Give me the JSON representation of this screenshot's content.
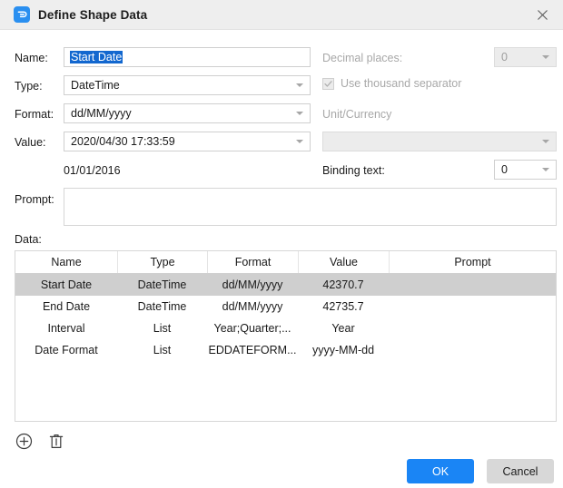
{
  "window": {
    "title": "Define Shape Data",
    "icon": "app-logo-icon",
    "close_label": "✕"
  },
  "form": {
    "name_label": "Name:",
    "name_value": "Start Date",
    "type_label": "Type:",
    "type_value": "DateTime",
    "format_label": "Format:",
    "format_value": "dd/MM/yyyy",
    "value_label": "Value:",
    "value_value": "2020/04/30 17:33:59",
    "value_preview": "01/01/2016",
    "prompt_label": "Prompt:",
    "prompt_value": "",
    "decimal_label": "Decimal places:",
    "decimal_value": "0",
    "thousand_sep_label": "Use thousand separator",
    "thousand_sep_checked": true,
    "unit_currency_label": "Unit/Currency",
    "unit_currency_value": "",
    "binding_text_label": "Binding text:",
    "binding_text_value": "0"
  },
  "data_section": {
    "label": "Data:",
    "columns": [
      "Name",
      "Type",
      "Format",
      "Value",
      "Prompt"
    ],
    "rows": [
      {
        "name": "Start Date",
        "type": "DateTime",
        "format": "dd/MM/yyyy",
        "value": "42370.7",
        "prompt": "",
        "selected": true
      },
      {
        "name": "End Date",
        "type": "DateTime",
        "format": "dd/MM/yyyy",
        "value": "42735.7",
        "prompt": "",
        "selected": false
      },
      {
        "name": "Interval",
        "type": "List",
        "format": "Year;Quarter;...",
        "value": "Year",
        "prompt": "",
        "selected": false
      },
      {
        "name": "Date Format",
        "type": "List",
        "format": "EDDATEFORM...",
        "value": "yyyy-MM-dd",
        "prompt": "",
        "selected": false
      }
    ]
  },
  "toolbar": {
    "add_icon": "add-circle-icon",
    "delete_icon": "trash-icon"
  },
  "footer": {
    "ok_label": "OK",
    "cancel_label": "Cancel"
  },
  "colors": {
    "accent": "#1a85f5",
    "selection": "#1267cf",
    "row_selected": "#cfcfcf",
    "titlebar": "#eeeeee",
    "disabled_text": "#a8a8a8"
  }
}
